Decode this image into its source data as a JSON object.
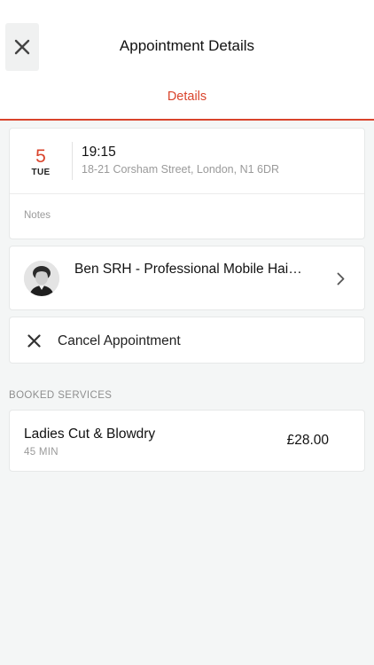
{
  "header": {
    "title": "Appointment Details",
    "close_icon": "close-icon"
  },
  "tabs": [
    {
      "label": "Details",
      "active": true
    }
  ],
  "appointment": {
    "day_number": "5",
    "day_name": "TUE",
    "time": "19:15",
    "address": "18-21 Corsham Street, London, N1 6DR",
    "notes_label": "Notes"
  },
  "stylist": {
    "name": "Ben SRH - Professional Mobile Hai…",
    "chevron_icon": "chevron-right-icon"
  },
  "cancel": {
    "label": "Cancel Appointment",
    "icon": "close-icon"
  },
  "booked_services": {
    "section_title": "BOOKED SERVICES",
    "items": [
      {
        "name": "Ladies Cut & Blowdry",
        "duration": "45 MIN",
        "price": "£28.00"
      }
    ]
  },
  "colors": {
    "accent": "#d9432b",
    "background": "#f4f6f6",
    "muted_text": "#9a9a9a"
  }
}
